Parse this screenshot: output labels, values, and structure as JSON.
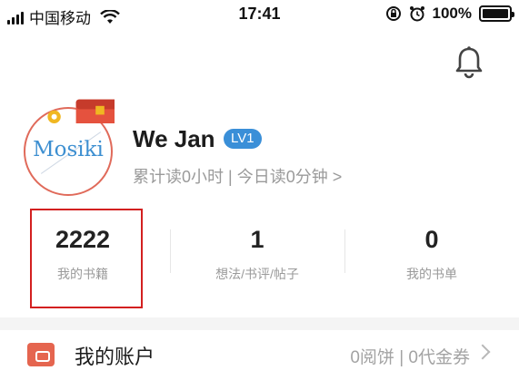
{
  "status_bar": {
    "carrier": "中国移动",
    "time": "17:41",
    "battery": "100%"
  },
  "profile": {
    "avatar_text": "Mosiki",
    "name": "We Jan",
    "level": "LV1",
    "reading_stats": "累计读0小时 | 今日读0分钟 >"
  },
  "stats": [
    {
      "value": "2222",
      "label": "我的书籍"
    },
    {
      "value": "1",
      "label": "想法/书评/帖子"
    },
    {
      "value": "0",
      "label": "我的书单"
    }
  ],
  "account": {
    "label": "我的账户",
    "value": "0阅饼 | 0代金券"
  },
  "icons": {
    "bell": "bell-icon",
    "wallet": "wallet-icon",
    "chevron": "chevron-right-icon"
  },
  "colors": {
    "accent_blue": "#3a8fd8",
    "wallet_red": "#e5654f",
    "highlight": "#d32020"
  }
}
